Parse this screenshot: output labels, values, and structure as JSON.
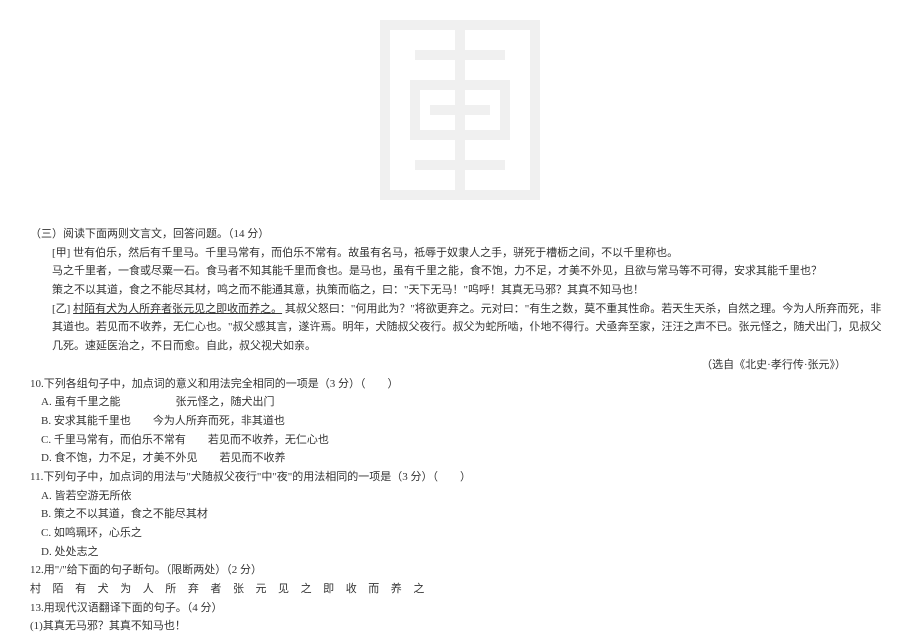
{
  "section_header": "（三）阅读下面两则文言文，回答问题。（14 分）",
  "text_jia_label": "[甲]",
  "text_jia_p1": "世有伯乐，然后有千里马。千里马常有，而伯乐不常有。故虽有名马，祗辱于奴隶人之手，骈死于槽枥之间，不以千里称也。",
  "text_jia_p2": "马之千里者，一食或尽粟一石。食马者不知其能千里而食也。是马也，虽有千里之能，食不饱，力不足，才美不外见，且欲与常马等不可得，安求其能千里也？",
  "text_jia_p3": "策之不以其道，食之不能尽其材，鸣之而不能通其意，执策而临之，曰：\"天下无马！\"呜呼！其真无马邪？其真不知马也！",
  "text_yi_label": "[乙]",
  "text_yi_underlined": "村陌有犬为人所弃者张元见之即收而养之。",
  "text_yi_p1": "其叔父怒曰：\"何用此为？\"将欲更弃之。元对曰：\"有生之数，莫不重其性命。若天生天杀，自然之理。今为人所弃而死，非其道也。若见而不收养，无仁心也。\"叔父感其言，遂许焉。明年，犬随叔父夜行。叔父为蛇所啮，仆地不得行。犬亟奔至家，汪汪之声不已。张元怪之，随犬出门，见叔父几死。速延医治之，不日而愈。自此，叔父视犬如亲。",
  "source": "（选自《北史·孝行传·张元》）",
  "q10": {
    "prompt": "10.下列各组句子中，加点词的意义和用法完全相同的一项是（3 分）（　　）",
    "a_main": "A. 虽有千里之能",
    "a_sub": "张元怪之，随犬出门",
    "b_main": "B. 安求其能千里也",
    "b_sub": "今为人所弃而死，非其道也",
    "c_main": "C. 千里马常有，而伯乐不常有",
    "c_sub": "若见而不收养，无仁心也",
    "d_main": "D. 食不饱，力不足，才美不外见",
    "d_sub": "若见而不收养"
  },
  "q11": {
    "prompt": "11.下列句子中，加点词的用法与\"犬随叔父夜行\"中\"夜\"的用法相同的一项是（3 分）（　　）",
    "a": "A. 皆若空游无所依",
    "b": "B. 策之不以其道，食之不能尽其材",
    "c": "C. 如鸣珮环，心乐之",
    "d": "D. 处处志之"
  },
  "q12": {
    "prompt": "12.用\"/\"给下面的句子断句。（限断两处）（2 分）",
    "chars": "村 陌 有 犬 为 人 所 弃 者 张 元 见 之 即 收 而 养 之"
  },
  "q13": {
    "prompt": "13.用现代汉语翻译下面的句子。（4 分）",
    "sub1": "(1)其真无马邪？其真不知马也！"
  }
}
